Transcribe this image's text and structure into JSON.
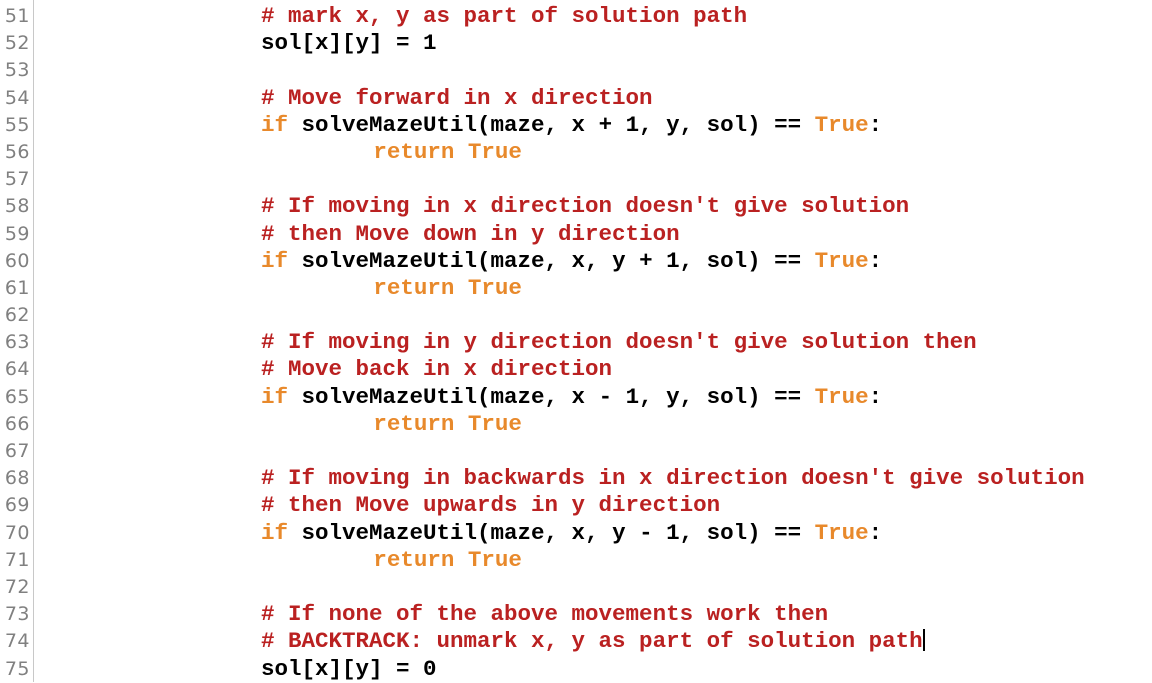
{
  "editor": {
    "background_color": "#ffffff",
    "gutter_text_color": "#808080",
    "gutter_border_color": "#c8c8c8",
    "comment_color": "#BA2121",
    "keyword_color": "#E8892B",
    "text_color": "#000000",
    "cursor_color": "#000000",
    "language": "Python",
    "first_line_number": 51,
    "last_line_number": 75
  },
  "lines": [
    {
      "number": "51",
      "indent": 0,
      "has_cursor": false,
      "text": "# mark x, y as part of solution path",
      "tokens": [
        {
          "type": "comment",
          "text": "# mark x, y as part of solution path"
        }
      ]
    },
    {
      "number": "52",
      "indent": 0,
      "has_cursor": false,
      "text": "sol[x][y] = 1",
      "tokens": [
        {
          "type": "plain",
          "text": "sol[x][y] = "
        },
        {
          "type": "number",
          "text": "1"
        }
      ]
    },
    {
      "number": "53",
      "indent": 0,
      "has_cursor": false,
      "text": "",
      "tokens": []
    },
    {
      "number": "54",
      "indent": 0,
      "has_cursor": false,
      "text": "# Move forward in x direction",
      "tokens": [
        {
          "type": "comment",
          "text": "# Move forward in x direction"
        }
      ]
    },
    {
      "number": "55",
      "indent": 0,
      "has_cursor": false,
      "text": "if solveMazeUtil(maze, x + 1, y, sol) == True:",
      "tokens": [
        {
          "type": "keyword",
          "text": "if"
        },
        {
          "type": "plain",
          "text": " solveMazeUtil(maze, x + 1, y, sol) == "
        },
        {
          "type": "builtin",
          "text": "True"
        },
        {
          "type": "plain",
          "text": ":"
        }
      ]
    },
    {
      "number": "56",
      "indent": 8,
      "has_cursor": false,
      "text": "return True",
      "tokens": [
        {
          "type": "keyword",
          "text": "return"
        },
        {
          "type": "plain",
          "text": " "
        },
        {
          "type": "builtin",
          "text": "True"
        }
      ]
    },
    {
      "number": "57",
      "indent": 0,
      "has_cursor": false,
      "text": "",
      "tokens": []
    },
    {
      "number": "58",
      "indent": 0,
      "has_cursor": false,
      "text": "# If moving in x direction doesn't give solution",
      "tokens": [
        {
          "type": "comment",
          "text": "# If moving in x direction doesn't give solution"
        }
      ]
    },
    {
      "number": "59",
      "indent": 0,
      "has_cursor": false,
      "text": "# then Move down in y direction",
      "tokens": [
        {
          "type": "comment",
          "text": "# then Move down in y direction"
        }
      ]
    },
    {
      "number": "60",
      "indent": 0,
      "has_cursor": false,
      "text": "if solveMazeUtil(maze, x, y + 1, sol) == True:",
      "tokens": [
        {
          "type": "keyword",
          "text": "if"
        },
        {
          "type": "plain",
          "text": " solveMazeUtil(maze, x, y + 1, sol) == "
        },
        {
          "type": "builtin",
          "text": "True"
        },
        {
          "type": "plain",
          "text": ":"
        }
      ]
    },
    {
      "number": "61",
      "indent": 8,
      "has_cursor": false,
      "text": "return True",
      "tokens": [
        {
          "type": "keyword",
          "text": "return"
        },
        {
          "type": "plain",
          "text": " "
        },
        {
          "type": "builtin",
          "text": "True"
        }
      ]
    },
    {
      "number": "62",
      "indent": 0,
      "has_cursor": false,
      "text": "",
      "tokens": []
    },
    {
      "number": "63",
      "indent": 0,
      "has_cursor": false,
      "text": "# If moving in y direction doesn't give solution then",
      "tokens": [
        {
          "type": "comment",
          "text": "# If moving in y direction doesn't give solution then"
        }
      ]
    },
    {
      "number": "64",
      "indent": 0,
      "has_cursor": false,
      "text": "# Move back in x direction",
      "tokens": [
        {
          "type": "comment",
          "text": "# Move back in x direction"
        }
      ]
    },
    {
      "number": "65",
      "indent": 0,
      "has_cursor": false,
      "text": "if solveMazeUtil(maze, x - 1, y, sol) == True:",
      "tokens": [
        {
          "type": "keyword",
          "text": "if"
        },
        {
          "type": "plain",
          "text": " solveMazeUtil(maze, x - 1, y, sol) == "
        },
        {
          "type": "builtin",
          "text": "True"
        },
        {
          "type": "plain",
          "text": ":"
        }
      ]
    },
    {
      "number": "66",
      "indent": 8,
      "has_cursor": false,
      "text": "return True",
      "tokens": [
        {
          "type": "keyword",
          "text": "return"
        },
        {
          "type": "plain",
          "text": " "
        },
        {
          "type": "builtin",
          "text": "True"
        }
      ]
    },
    {
      "number": "67",
      "indent": 0,
      "has_cursor": false,
      "text": "",
      "tokens": []
    },
    {
      "number": "68",
      "indent": 0,
      "has_cursor": false,
      "text": "# If moving in backwards in x direction doesn't give solution",
      "tokens": [
        {
          "type": "comment",
          "text": "# If moving in backwards in x direction doesn't give solution"
        }
      ]
    },
    {
      "number": "69",
      "indent": 0,
      "has_cursor": false,
      "text": "# then Move upwards in y direction",
      "tokens": [
        {
          "type": "comment",
          "text": "# then Move upwards in y direction"
        }
      ]
    },
    {
      "number": "70",
      "indent": 0,
      "has_cursor": false,
      "text": "if solveMazeUtil(maze, x, y - 1, sol) == True:",
      "tokens": [
        {
          "type": "keyword",
          "text": "if"
        },
        {
          "type": "plain",
          "text": " solveMazeUtil(maze, x, y - 1, sol) == "
        },
        {
          "type": "builtin",
          "text": "True"
        },
        {
          "type": "plain",
          "text": ":"
        }
      ]
    },
    {
      "number": "71",
      "indent": 8,
      "has_cursor": false,
      "text": "return True",
      "tokens": [
        {
          "type": "keyword",
          "text": "return"
        },
        {
          "type": "plain",
          "text": " "
        },
        {
          "type": "builtin",
          "text": "True"
        }
      ]
    },
    {
      "number": "72",
      "indent": 0,
      "has_cursor": false,
      "text": "",
      "tokens": []
    },
    {
      "number": "73",
      "indent": 0,
      "has_cursor": false,
      "text": "# If none of the above movements work then",
      "tokens": [
        {
          "type": "comment",
          "text": "# If none of the above movements work then"
        }
      ]
    },
    {
      "number": "74",
      "indent": 0,
      "has_cursor": true,
      "text": "# BACKTRACK: unmark x, y as part of solution path",
      "tokens": [
        {
          "type": "comment",
          "text": "# BACKTRACK: unmark x, y as part of solution path"
        }
      ]
    },
    {
      "number": "75",
      "indent": 0,
      "has_cursor": false,
      "text": "sol[x][y] = 0",
      "tokens": [
        {
          "type": "plain",
          "text": "sol[x][y] = "
        },
        {
          "type": "number",
          "text": "0"
        }
      ]
    }
  ]
}
